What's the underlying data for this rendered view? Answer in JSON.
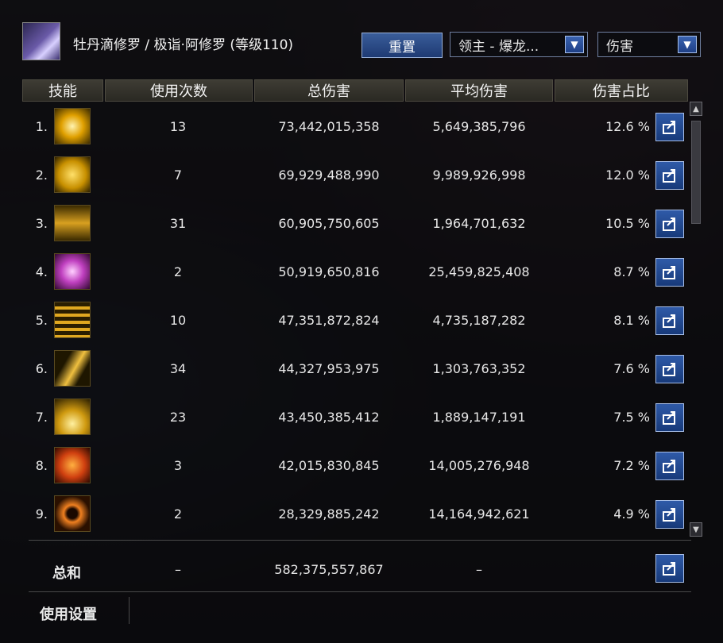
{
  "header": {
    "title": "牡丹滴修罗 / 极诣·阿修罗 (等级110)",
    "reset_label": "重置",
    "target_select": "领主 - 爆龙...",
    "type_select": "伤害"
  },
  "columns": [
    "技能",
    "使用次数",
    "总伤害",
    "平均伤害",
    "伤害占比"
  ],
  "rows": [
    {
      "rank": "1.",
      "icon": "burst-icon",
      "uses": "13",
      "total": "73,442,015,358",
      "avg": "5,649,385,796",
      "pct": "12.6 %"
    },
    {
      "rank": "2.",
      "icon": "lightning-cloud-icon",
      "uses": "7",
      "total": "69,929,488,990",
      "avg": "9,989,926,998",
      "pct": "12.0 %"
    },
    {
      "rank": "3.",
      "icon": "warrior-silhouette-icon",
      "uses": "31",
      "total": "60,905,750,605",
      "avg": "1,964,701,632",
      "pct": "10.5 %"
    },
    {
      "rank": "4.",
      "icon": "sword-magic-icon",
      "uses": "2",
      "total": "50,919,650,816",
      "avg": "25,459,825,408",
      "pct": "8.7 %"
    },
    {
      "rank": "5.",
      "icon": "golden-ring-icon",
      "uses": "10",
      "total": "47,351,872,824",
      "avg": "4,735,187,282",
      "pct": "8.1 %"
    },
    {
      "rank": "6.",
      "icon": "wave-slash-icon",
      "uses": "34",
      "total": "44,327,953,975",
      "avg": "1,303,763,352",
      "pct": "7.6 %"
    },
    {
      "rank": "7.",
      "icon": "crown-spike-icon",
      "uses": "23",
      "total": "43,450,385,412",
      "avg": "1,889,147,191",
      "pct": "7.5 %"
    },
    {
      "rank": "8.",
      "icon": "flame-demon-icon",
      "uses": "3",
      "total": "42,015,830,845",
      "avg": "14,005,276,948",
      "pct": "7.2 %"
    },
    {
      "rank": "9.",
      "icon": "eye-sigil-icon",
      "uses": "2",
      "total": "28,329,885,242",
      "avg": "14,164,942,621",
      "pct": "4.9 %"
    }
  ],
  "total": {
    "label": "总和",
    "uses": "–",
    "total": "582,375,557,867",
    "avg": "–"
  },
  "settings_label": "使用设置"
}
